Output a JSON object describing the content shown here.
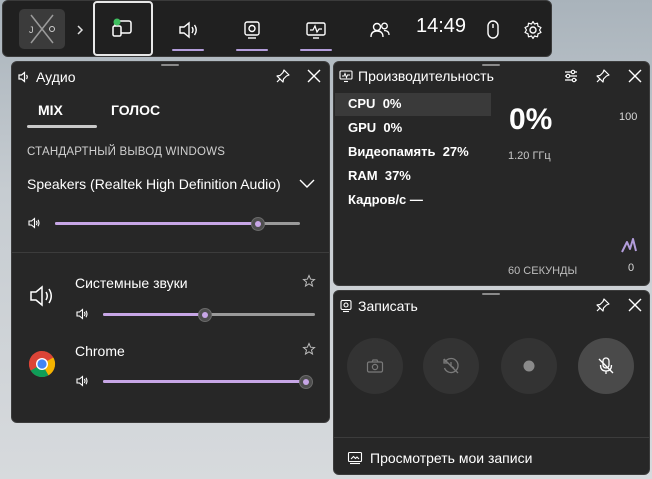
{
  "topbar": {
    "time": "14:49"
  },
  "audio": {
    "title": "Аудио",
    "tabs": [
      "MIX",
      "ГОЛОС"
    ],
    "output_section": "СТАНДАРТНЫЙ ВЫВОД WINDOWS",
    "device": "Speakers (Realtek High Definition Audio)",
    "master_volume": 0.83,
    "apps": [
      {
        "name": "Системные звуки",
        "volume": 0.48
      },
      {
        "name": "Chrome",
        "volume": 1.0
      }
    ],
    "accent": "#c7a6e6"
  },
  "performance": {
    "title": "Производительность",
    "rows": [
      {
        "label": "CPU",
        "value": "0%"
      },
      {
        "label": "GPU",
        "value": "0%"
      },
      {
        "label": "Видеопамять",
        "value": "27%"
      },
      {
        "label": "RAM",
        "value": "37%"
      },
      {
        "label": "Кадров/с",
        "value": "—"
      }
    ],
    "big_value": "0%",
    "frequency": "1.20 ГГц",
    "max": "100",
    "min": "0",
    "window": "60 СЕКУНДЫ"
  },
  "capture": {
    "title": "Записать",
    "view_recordings": "Просмотреть мои записи"
  }
}
